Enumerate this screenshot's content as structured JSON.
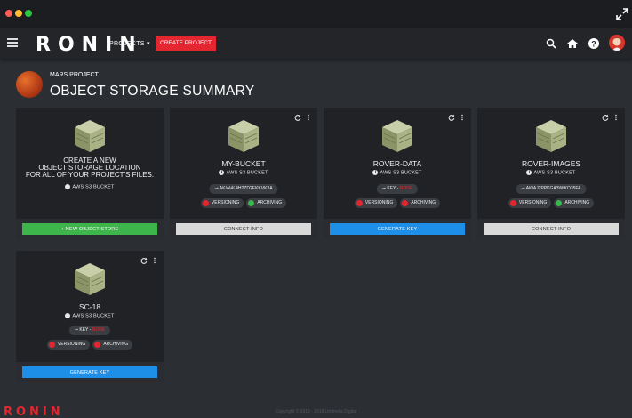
{
  "navbar": {
    "logo": "RONIN",
    "projects_label": "PROJECTS ▾",
    "create_project_label": "CREATE PROJECT"
  },
  "header": {
    "project_name": "MARS PROJECT",
    "title": "OBJECT STORAGE SUMMARY"
  },
  "create_card": {
    "line1": "CREATE A NEW",
    "line2": "OBJECT STORAGE LOCATION",
    "line3": "FOR ALL OF YOUR PROJECT'S FILES.",
    "type": "AWS S3 BUCKET",
    "button": "+ NEW OBJECT STORE",
    "button_color": "#3db54a"
  },
  "buckets": [
    {
      "name": "MY-BUCKET",
      "type": "AWS S3 BUCKET",
      "key_label": "AKIAI4L4H2ZD2EKKVK3A",
      "key_none": "",
      "versioning": "VERSIONING",
      "versioning_color": "#e3262f",
      "archiving": "ARCHIVING",
      "archiving_color": "#3db54a",
      "button": "CONNECT INFO",
      "button_color": "#d9d9d9"
    },
    {
      "name": "ROVER-DATA",
      "type": "AWS S3 BUCKET",
      "key_label": "KEY - ",
      "key_none": "NONE",
      "versioning": "VERSIONING",
      "versioning_color": "#e3262f",
      "archiving": "ARCHIVING",
      "archiving_color": "#e3262f",
      "button": "GENERATE KEY",
      "button_color": "#1e8fe8"
    },
    {
      "name": "ROVER-IMAGES",
      "type": "AWS S3 BUCKET",
      "key_label": "AKIAJ2PPKGA3WIKO35FA",
      "key_none": "",
      "versioning": "VERSIONING",
      "versioning_color": "#e3262f",
      "archiving": "ARCHIVING",
      "archiving_color": "#3db54a",
      "button": "CONNECT INFO",
      "button_color": "#d9d9d9"
    },
    {
      "name": "SC-18",
      "type": "AWS S3 BUCKET",
      "key_label": "KEY - ",
      "key_none": "NONE",
      "versioning": "VERSIONING",
      "versioning_color": "#e3262f",
      "archiving": "ARCHIVING",
      "archiving_color": "#e3262f",
      "button": "GENERATE KEY",
      "button_color": "#1e8fe8"
    }
  ],
  "footer": {
    "logo": "RONIN",
    "copyright": "Copyright © 2012 - 2018 Umbrella Digital"
  },
  "colors": {
    "accent": "#e3262f",
    "background": "#2b2e33",
    "card": "#202226"
  },
  "icons": {
    "menu": "hamburger-menu-icon",
    "search": "search-icon",
    "home": "home-icon",
    "help": "help-icon",
    "refresh": "refresh-icon",
    "more": "more-vertical-icon",
    "storage": "storage-box-icon",
    "key": "key-icon",
    "info": "info-icon"
  }
}
